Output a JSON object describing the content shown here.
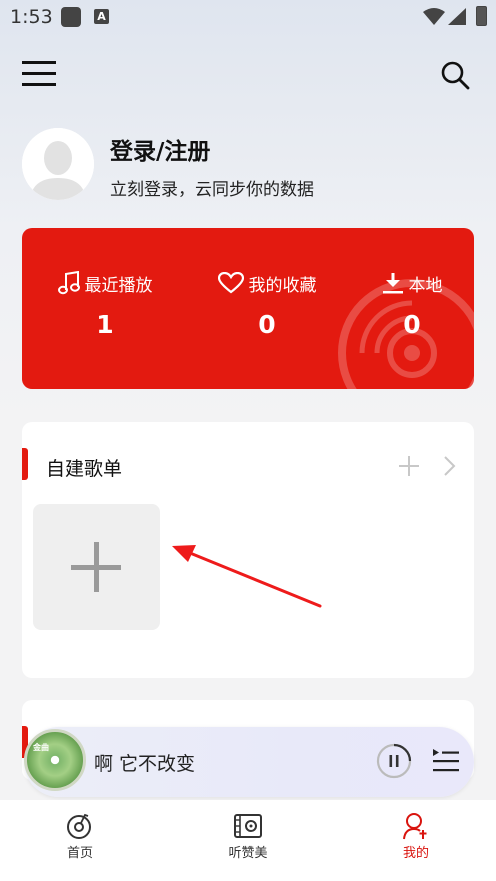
{
  "status_bar": {
    "time": "1:53",
    "a_icon": "A"
  },
  "header": {
    "menu_icon": "hamburger-icon",
    "search_icon": "search-icon"
  },
  "profile": {
    "title": "登录/注册",
    "subtitle": "立刻登录，云同步你的数据"
  },
  "stats": {
    "accent": "#e31a10",
    "items": [
      {
        "label": "最近播放",
        "count": "1",
        "icon": "music-note-icon"
      },
      {
        "label": "我的收藏",
        "count": "0",
        "icon": "heart-icon"
      },
      {
        "label": "本地",
        "count": "0",
        "icon": "download-icon"
      }
    ]
  },
  "playlists": {
    "title": "自建歌单"
  },
  "player": {
    "song": "啊 它不改变",
    "cover_text": "金曲"
  },
  "tabs": [
    {
      "label": "首页",
      "icon": "disc-note-icon"
    },
    {
      "label": "听赞美",
      "icon": "film-reel-icon"
    },
    {
      "label": "我的",
      "icon": "user-icon",
      "active_color": "#d9140e"
    }
  ]
}
